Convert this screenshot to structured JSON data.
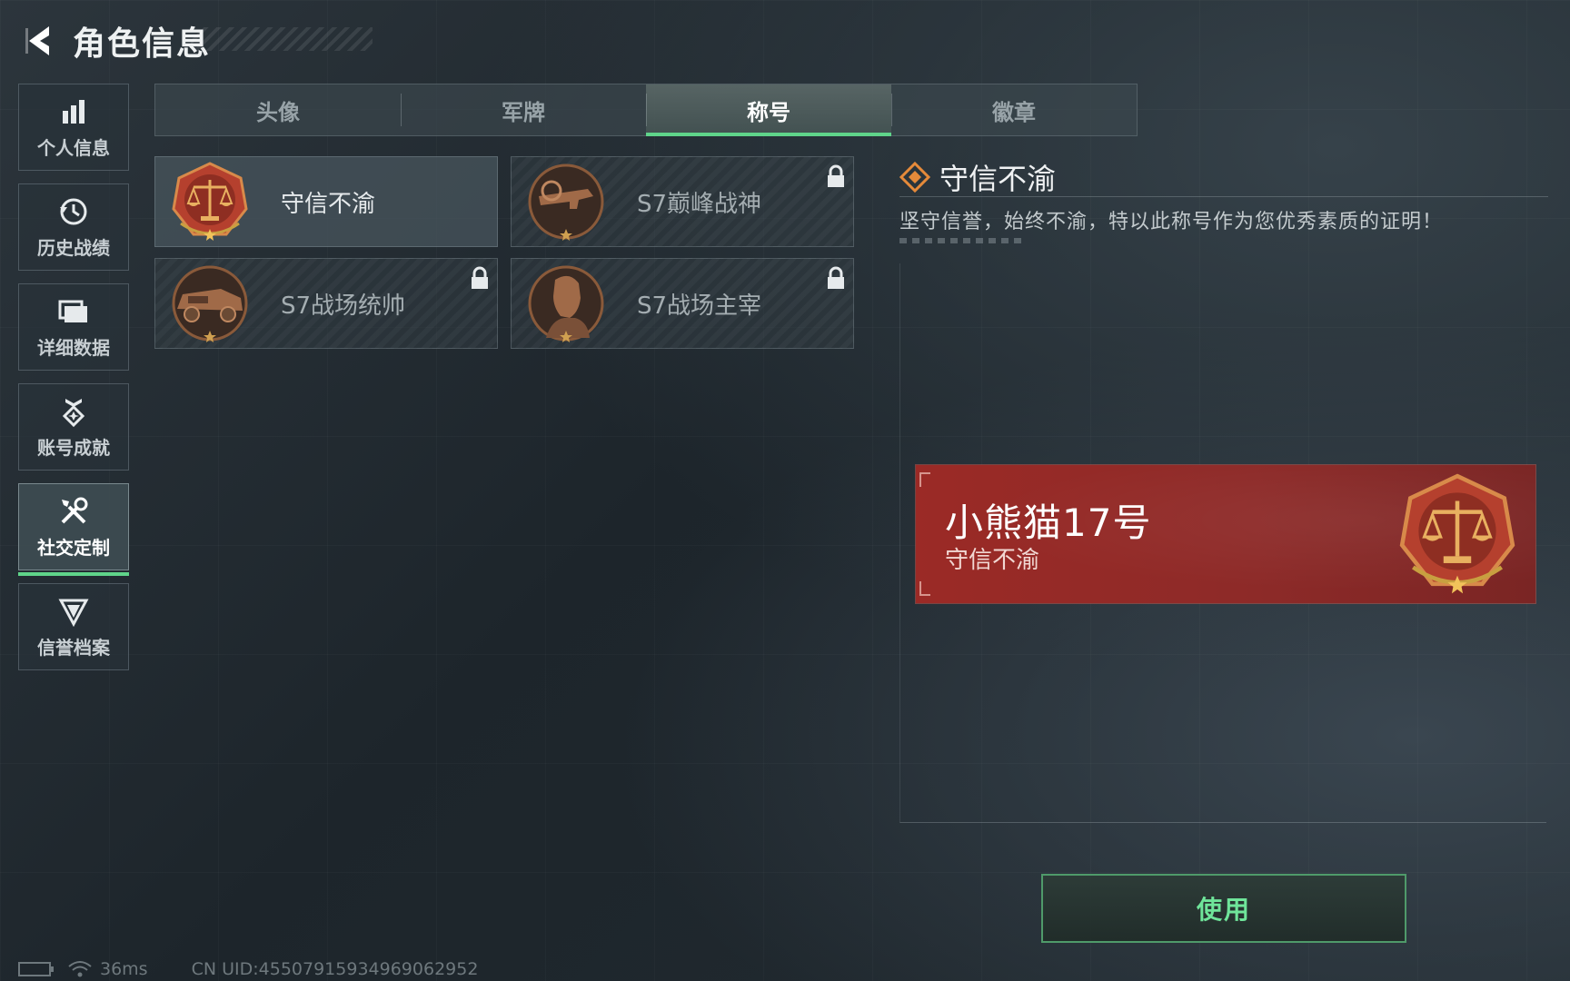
{
  "header": {
    "title": "角色信息"
  },
  "sidebar": {
    "items": [
      {
        "label": "个人信息",
        "icon": "bar-chart-icon"
      },
      {
        "label": "历史战绩",
        "icon": "history-icon"
      },
      {
        "label": "详细数据",
        "icon": "folder-icon"
      },
      {
        "label": "账号成就",
        "icon": "achievement-icon"
      },
      {
        "label": "社交定制",
        "icon": "tools-icon",
        "active": true
      },
      {
        "label": "信誉档案",
        "icon": "reputation-icon"
      }
    ]
  },
  "tabs": [
    {
      "label": "头像"
    },
    {
      "label": "军牌"
    },
    {
      "label": "称号",
      "active": true
    },
    {
      "label": "徽章"
    }
  ],
  "titles": [
    {
      "label": "守信不渝",
      "locked": false,
      "selected": true,
      "icon": "scales-medal-icon"
    },
    {
      "label": "S7巅峰战神",
      "locked": true,
      "icon": "rifle-medal-icon"
    },
    {
      "label": "S7战场统帅",
      "locked": true,
      "icon": "vehicle-medal-icon"
    },
    {
      "label": "S7战场主宰",
      "locked": true,
      "icon": "soldier-medal-icon"
    }
  ],
  "detail": {
    "name": "守信不渝",
    "description": "坚守信誉，始终不渝，特以此称号作为您优秀素质的证明！"
  },
  "nameplate": {
    "player_name": "小熊猫17号",
    "title": "守信不渝"
  },
  "use_button": {
    "label": "使用"
  },
  "footer": {
    "ping": "36ms",
    "uid": "CN UID:4550791593496906295​2"
  },
  "colors": {
    "accent_green": "#5fd48a",
    "nameplate_red": "#9b2a26",
    "medal_gold": "#c8893a"
  }
}
